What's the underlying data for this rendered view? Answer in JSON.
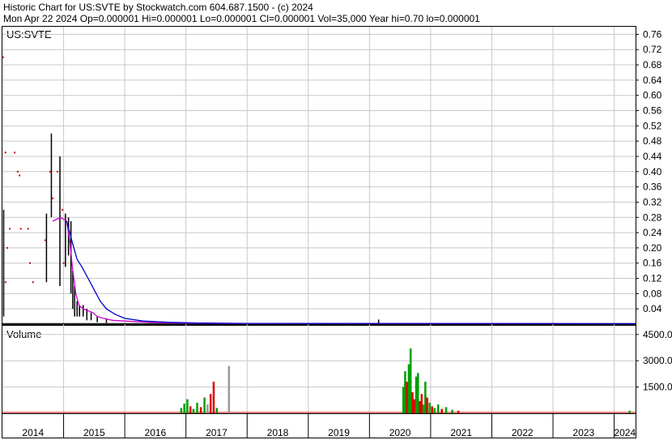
{
  "header": {
    "line1": "Historic Chart for US:SVTE by Stockwatch.com 604.687.1500 - (c) 2024",
    "line2": "Mon Apr 22 2024   Op=0.000001  Hi=0.000001  Lo=0.000001  Cl=0.000001  Vol=35,000   Year hi=0.70   lo=0.000001"
  },
  "colors": {
    "price_bar": "#000000",
    "ma_short": "#cc00cc",
    "ma_long": "#0000cc",
    "dot": "#cc0000",
    "vol_up": "#00a000",
    "vol_down": "#e00000",
    "vol_neutral": "#999999",
    "grid": "#c8c8c8"
  },
  "chart_data": [
    {
      "type": "bar",
      "title": "US:SVTE",
      "panel": "price",
      "y_ticks": [
        "0.76",
        "0.72",
        "0.68",
        "0.64",
        "0.60",
        "0.56",
        "0.52",
        "0.48",
        "0.44",
        "0.40",
        "0.36",
        "0.32",
        "0.28",
        "0.24",
        "0.20",
        "0.16",
        "0.12",
        "0.08",
        "0.04"
      ],
      "ylim": [
        0,
        0.78
      ],
      "x_ticks": [
        "2014",
        "2015",
        "2016",
        "2017",
        "2018",
        "2019",
        "2020",
        "2021",
        "2022",
        "2023",
        "2024"
      ],
      "xlim": [
        2014.0,
        2024.35
      ],
      "ohlc_bars": [
        {
          "x": 2014.02,
          "hi": 0.3,
          "lo": 0.02
        },
        {
          "x": 2014.72,
          "hi": 0.29,
          "lo": 0.11
        },
        {
          "x": 2014.8,
          "hi": 0.5,
          "lo": 0.28
        },
        {
          "x": 2014.94,
          "hi": 0.44,
          "lo": 0.1
        },
        {
          "x": 2015.03,
          "hi": 0.29,
          "lo": 0.15
        },
        {
          "x": 2015.08,
          "hi": 0.28,
          "lo": 0.18
        },
        {
          "x": 2015.12,
          "hi": 0.27,
          "lo": 0.08
        },
        {
          "x": 2015.15,
          "hi": 0.14,
          "lo": 0.04
        },
        {
          "x": 2015.18,
          "hi": 0.1,
          "lo": 0.02
        },
        {
          "x": 2015.22,
          "hi": 0.06,
          "lo": 0.02
        },
        {
          "x": 2015.26,
          "hi": 0.05,
          "lo": 0.02
        },
        {
          "x": 2015.32,
          "hi": 0.05,
          "lo": 0.02
        },
        {
          "x": 2015.38,
          "hi": 0.04,
          "lo": 0.01
        },
        {
          "x": 2015.45,
          "hi": 0.03,
          "lo": 0.01
        },
        {
          "x": 2015.55,
          "hi": 0.02,
          "lo": 0.005
        },
        {
          "x": 2015.7,
          "hi": 0.015,
          "lo": 0.003
        },
        {
          "x": 2020.15,
          "hi": 0.012,
          "lo": 0.0
        }
      ],
      "dots": [
        {
          "x": 2014.01,
          "y": 0.7
        },
        {
          "x": 2014.05,
          "y": 0.45
        },
        {
          "x": 2014.2,
          "y": 0.45
        },
        {
          "x": 2014.25,
          "y": 0.4
        },
        {
          "x": 2014.28,
          "y": 0.39
        },
        {
          "x": 2014.08,
          "y": 0.2
        },
        {
          "x": 2014.12,
          "y": 0.25
        },
        {
          "x": 2014.3,
          "y": 0.25
        },
        {
          "x": 2014.42,
          "y": 0.25
        },
        {
          "x": 2014.45,
          "y": 0.16
        },
        {
          "x": 2014.5,
          "y": 0.11
        },
        {
          "x": 2014.05,
          "y": 0.11
        },
        {
          "x": 2014.78,
          "y": 0.4
        },
        {
          "x": 2014.82,
          "y": 0.33
        },
        {
          "x": 2014.9,
          "y": 0.4
        },
        {
          "x": 2014.98,
          "y": 0.3
        },
        {
          "x": 2014.7,
          "y": 0.22
        },
        {
          "x": 2015.0,
          "y": 0.16
        }
      ],
      "series": [
        {
          "x": [
            2014.82,
            2014.95,
            2015.05,
            2015.1,
            2015.15,
            2015.2,
            2015.25,
            2015.32,
            2015.4,
            2015.48,
            2015.55,
            2015.65,
            2015.8,
            2016.0,
            2016.5,
            2017.5,
            2024.35
          ],
          "values": [
            0.27,
            0.28,
            0.27,
            0.22,
            0.14,
            0.08,
            0.05,
            0.04,
            0.035,
            0.03,
            0.02,
            0.015,
            0.01,
            0.008,
            0.004,
            0.002,
            0.001
          ]
        },
        {
          "x": [
            2015.05,
            2015.15,
            2015.22,
            2015.3,
            2015.4,
            2015.5,
            2015.6,
            2015.7,
            2015.85,
            2016.0,
            2016.3,
            2016.7,
            2017.2,
            2018.0,
            2024.35
          ],
          "values": [
            0.27,
            0.21,
            0.17,
            0.15,
            0.12,
            0.09,
            0.06,
            0.04,
            0.025,
            0.015,
            0.008,
            0.005,
            0.003,
            0.002,
            0.001
          ]
        }
      ]
    },
    {
      "type": "bar",
      "title": "Volume",
      "panel": "volume",
      "y_ticks": [
        "4500.0",
        "3000.0",
        "1500.0"
      ],
      "ylim": [
        0,
        5000
      ],
      "bars": [
        {
          "x": 2016.92,
          "v": 300,
          "c": "up"
        },
        {
          "x": 2016.97,
          "v": 550,
          "c": "up"
        },
        {
          "x": 2017.02,
          "v": 800,
          "c": "up"
        },
        {
          "x": 2017.07,
          "v": 400,
          "c": "down"
        },
        {
          "x": 2017.12,
          "v": 250,
          "c": "up"
        },
        {
          "x": 2017.18,
          "v": 600,
          "c": "up"
        },
        {
          "x": 2017.24,
          "v": 350,
          "c": "down"
        },
        {
          "x": 2017.3,
          "v": 900,
          "c": "up"
        },
        {
          "x": 2017.35,
          "v": 500,
          "c": "neutral"
        },
        {
          "x": 2017.4,
          "v": 1100,
          "c": "down"
        },
        {
          "x": 2017.45,
          "v": 1800,
          "c": "down"
        },
        {
          "x": 2017.5,
          "v": 300,
          "c": "up"
        },
        {
          "x": 2017.7,
          "v": 2700,
          "c": "neutral"
        },
        {
          "x": 2020.55,
          "v": 1500,
          "c": "up"
        },
        {
          "x": 2020.58,
          "v": 2400,
          "c": "up"
        },
        {
          "x": 2020.61,
          "v": 1800,
          "c": "down"
        },
        {
          "x": 2020.64,
          "v": 2800,
          "c": "up"
        },
        {
          "x": 2020.67,
          "v": 3700,
          "c": "up"
        },
        {
          "x": 2020.7,
          "v": 1200,
          "c": "down"
        },
        {
          "x": 2020.73,
          "v": 800,
          "c": "down"
        },
        {
          "x": 2020.76,
          "v": 2100,
          "c": "up"
        },
        {
          "x": 2020.79,
          "v": 2300,
          "c": "up"
        },
        {
          "x": 2020.82,
          "v": 700,
          "c": "down"
        },
        {
          "x": 2020.85,
          "v": 1100,
          "c": "down"
        },
        {
          "x": 2020.88,
          "v": 500,
          "c": "up"
        },
        {
          "x": 2020.91,
          "v": 1800,
          "c": "up"
        },
        {
          "x": 2020.94,
          "v": 900,
          "c": "down"
        },
        {
          "x": 2020.98,
          "v": 600,
          "c": "up"
        },
        {
          "x": 2021.02,
          "v": 400,
          "c": "down"
        },
        {
          "x": 2021.06,
          "v": 300,
          "c": "up"
        },
        {
          "x": 2021.12,
          "v": 500,
          "c": "up"
        },
        {
          "x": 2021.18,
          "v": 250,
          "c": "down"
        },
        {
          "x": 2021.25,
          "v": 350,
          "c": "up"
        },
        {
          "x": 2021.35,
          "v": 200,
          "c": "up"
        },
        {
          "x": 2021.45,
          "v": 150,
          "c": "down"
        },
        {
          "x": 2024.25,
          "v": 150,
          "c": "up"
        }
      ]
    }
  ]
}
